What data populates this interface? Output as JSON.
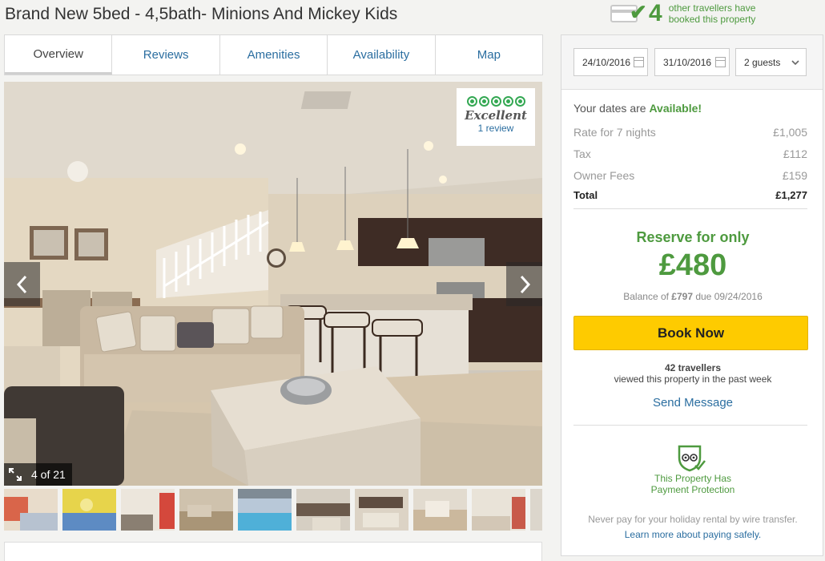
{
  "title": "Brand New 5bed - 4,5bath- Minions And Mickey Kids",
  "booked": {
    "count": "4",
    "text": "other travellers have booked this property"
  },
  "tabs": [
    "Overview",
    "Reviews",
    "Amenities",
    "Availability",
    "Map"
  ],
  "gallery": {
    "rating_label": "Excellent",
    "rating_link": "1 review",
    "counter": "4 of 21"
  },
  "booking": {
    "checkin": "24/10/2016",
    "checkout": "31/10/2016",
    "guests": "2 guests",
    "availability_prefix": "Your dates are ",
    "availability_status": "Available!",
    "rows": [
      {
        "label": "Rate for 7 nights",
        "value": "£1,005"
      },
      {
        "label": "Tax",
        "value": "£112"
      },
      {
        "label": "Owner Fees",
        "value": "£159"
      }
    ],
    "total_label": "Total",
    "total_value": "£1,277",
    "reserve_text": "Reserve for only",
    "reserve_amount": "£480",
    "balance_prefix": "Balance of ",
    "balance_amount": "£797",
    "balance_suffix": " due 09/24/2016",
    "book_button": "Book Now",
    "viewed_count": "42 travellers",
    "viewed_text": "viewed this property in the past week",
    "send_message": "Send Message",
    "protection_line1": "This Property Has",
    "protection_line2": "Payment Protection",
    "note": "Never pay for your holiday rental by wire transfer.",
    "learn_more": "Learn more about paying safely."
  },
  "colors": {
    "accent_green": "#4e9a3f",
    "link_blue": "#2b6ea0",
    "book_yellow": "#fecb00",
    "rating_green": "#34a853"
  },
  "icons": [
    "credit-card-icon",
    "check-icon",
    "calendar-icon",
    "chevron-down-icon",
    "chevron-left-icon",
    "chevron-right-icon",
    "expand-icon",
    "shield-icon",
    "rating-bubble-icon"
  ]
}
